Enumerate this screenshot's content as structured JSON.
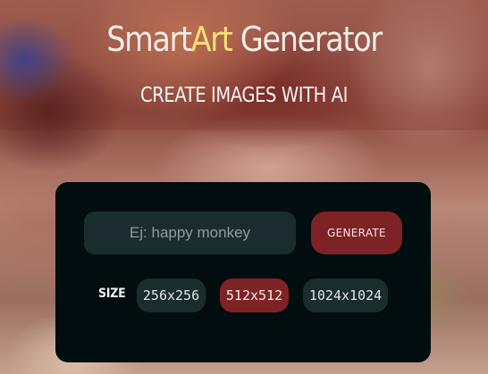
{
  "header": {
    "title_part1": "Smart",
    "title_accent": "Art",
    "title_part2": " Generator",
    "subtitle": "CREATE IMAGES WITH AI"
  },
  "form": {
    "prompt_placeholder": "Ej: happy monkey",
    "prompt_value": "",
    "generate_label": "GENERATE",
    "size_label": "SIZE",
    "sizes": [
      "256x256",
      "512x512",
      "1024x1024"
    ],
    "selected_size": "512x512"
  },
  "colors": {
    "accent_yellow": "#f7e07a",
    "primary_red": "#7f2226",
    "panel_bg": "#020d10",
    "control_bg": "#1b2c2e"
  }
}
